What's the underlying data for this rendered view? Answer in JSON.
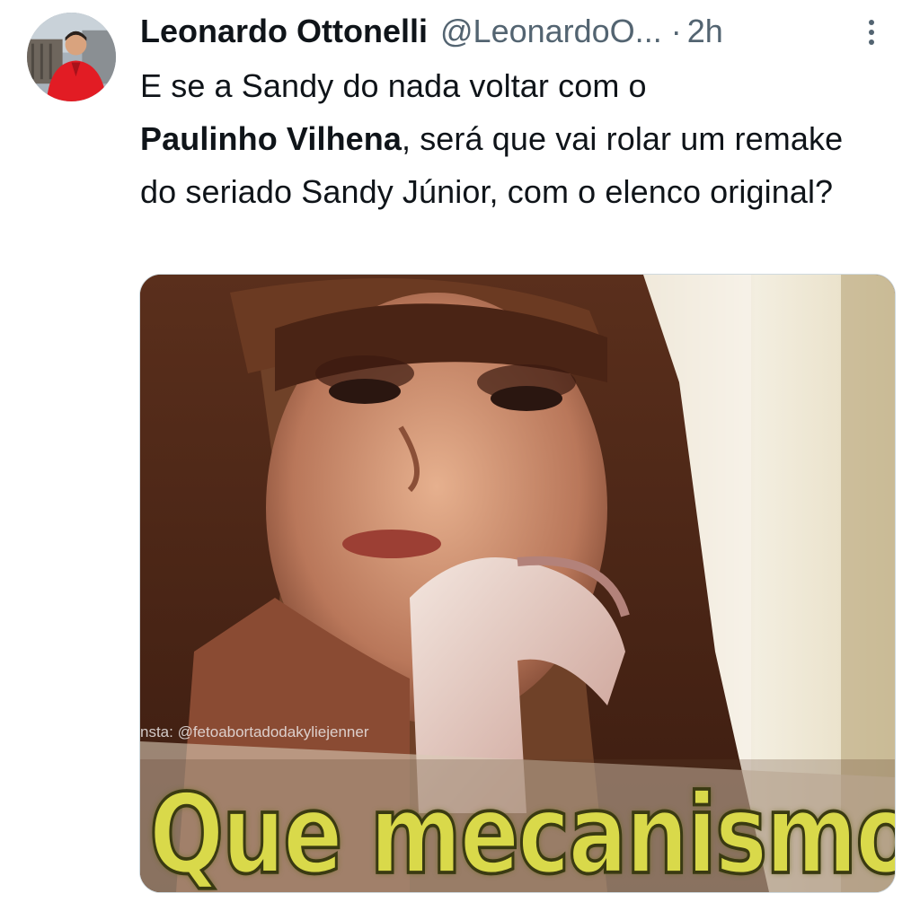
{
  "tweet": {
    "display_name": "Leonardo Ottonelli",
    "handle": "@LeonardoO...",
    "separator": "·",
    "time": "2h",
    "text_part1": "E se a Sandy do nada voltar com o",
    "text_bold": "Paulinho Vilhena",
    "text_part2": ", será que vai rolar um remake do seriado Sandy Júnior, com o elenco original?",
    "avatar_icon": "user-avatar",
    "more_icon": "more-vertical-icon"
  },
  "media": {
    "watermark": "nsta: @fetoabortadodakyliejenner",
    "caption": "Que mecanismo!"
  },
  "colors": {
    "text_primary": "#0f1419",
    "text_secondary": "#536471",
    "caption": "#d9d94a"
  }
}
